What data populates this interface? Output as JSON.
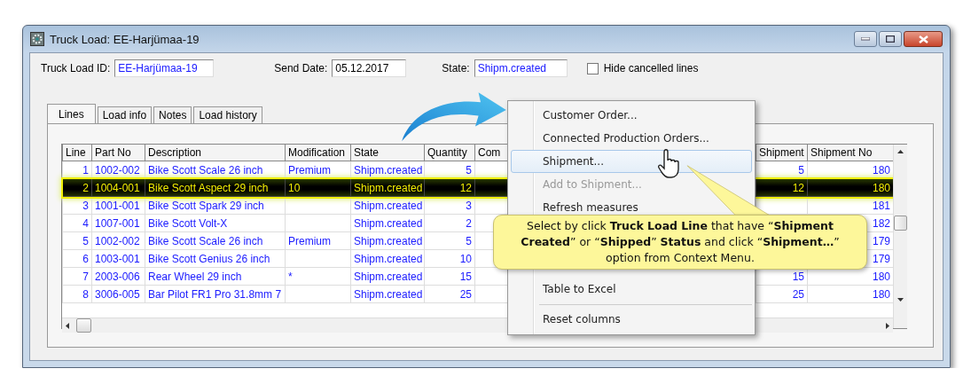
{
  "window": {
    "title": "Truck Load: EE-Harjümaa-19"
  },
  "header_fields": [
    {
      "label": "Truck Load ID:",
      "value": "EE-Harjümaa-19",
      "kind": "link"
    },
    {
      "label": "Send Date:",
      "value": "05.12.2017",
      "kind": "plain"
    },
    {
      "label": "State:",
      "value": "Shipm.created",
      "kind": "link"
    }
  ],
  "hide_cancelled": {
    "label": "Hide cancelled lines",
    "checked": false
  },
  "tabs": [
    {
      "label": "Lines",
      "selected": true
    },
    {
      "label": "Load info",
      "selected": false
    },
    {
      "label": "Notes",
      "selected": false
    },
    {
      "label": "Load history",
      "selected": false
    }
  ],
  "table": {
    "columns": [
      "Line",
      "Part No",
      "Description",
      "Modification",
      "State",
      "Quantity",
      "Com",
      "Shipment",
      "Shipment No"
    ],
    "rows": [
      {
        "line": "1",
        "part_no": "1002-002",
        "description": "Bike Scott Scale 26 inch",
        "modification": "Premium",
        "state": "Shipm.created",
        "quantity": "5",
        "shipment": "5",
        "shipment_no": "180",
        "selected": false
      },
      {
        "line": "2",
        "part_no": "1004-001",
        "description": "Bike Scott Aspect 29 inch",
        "modification": "10",
        "state": "Shipm.created",
        "quantity": "12",
        "shipment": "12",
        "shipment_no": "180",
        "selected": true
      },
      {
        "line": "3",
        "part_no": "1001-001",
        "description": "Bike Scott Spark 29 inch",
        "state": "Shipm.created",
        "quantity": "3",
        "shipment_no": "181",
        "selected": false
      },
      {
        "line": "4",
        "part_no": "1007-001",
        "description": "Bike Scott Volt-X",
        "state": "Shipm.created",
        "quantity": "2",
        "shipment_no": "182",
        "selected": false
      },
      {
        "line": "5",
        "part_no": "1002-002",
        "description": "Bike Scott Scale 26 inch",
        "modification": "Premium",
        "state": "Shipm.created",
        "quantity": "5",
        "shipment_no": "179",
        "selected": false
      },
      {
        "line": "6",
        "part_no": "1003-001",
        "description": "Bike Scott Genius 26 inch",
        "state": "Shipm.created",
        "quantity": "10",
        "shipment_no": "179",
        "selected": false
      },
      {
        "line": "7",
        "part_no": "2003-006",
        "description": "Rear Wheel 29 inch",
        "modification": "*",
        "state": "Shipm.created",
        "quantity": "15",
        "shipment": "15",
        "shipment_no": "180",
        "selected": false
      },
      {
        "line": "8",
        "part_no": "3006-005",
        "description": "Bar Pilot FR1 Pro 31.8mm 7",
        "state": "Shipm.created",
        "quantity": "25",
        "shipment": "25",
        "shipment_no": "180",
        "selected": false
      }
    ]
  },
  "context_menu": {
    "top_items": [
      {
        "label": "Customer Order...",
        "selected": false,
        "disabled": false
      },
      {
        "label": "Connected Production Orders...",
        "selected": false,
        "disabled": false
      },
      {
        "label": "Shipment...",
        "selected": true,
        "disabled": false
      },
      {
        "label": "Add to Shipment...",
        "selected": false,
        "disabled": true
      },
      {
        "label": "Refresh measures",
        "selected": false,
        "disabled": false
      }
    ],
    "middle_items": [
      {
        "label": "Table to Excel",
        "selected": false,
        "disabled": false
      }
    ],
    "bottom_items": [
      {
        "label": "Reset columns",
        "selected": false,
        "disabled": false
      }
    ]
  },
  "callout": {
    "text": "Select by click **Truck Load Line** that have “**Shipment Created**” or “**Shipped**”  **Status** and click “**Shipment…**” option from Context Menu."
  }
}
